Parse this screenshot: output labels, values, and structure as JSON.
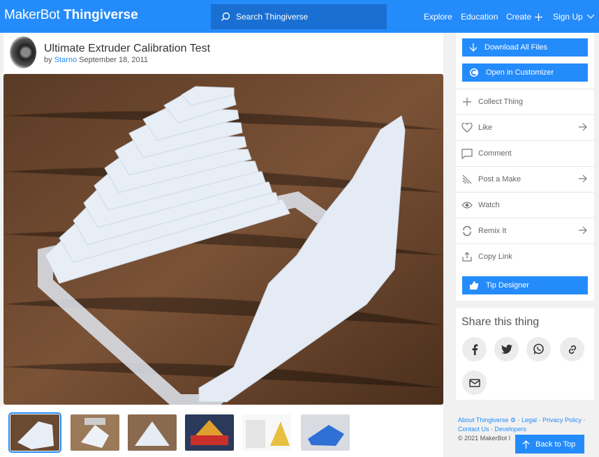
{
  "header": {
    "logo_makerbot": "MakerBot",
    "logo_thingiverse": "Thingiverse",
    "search_placeholder": "Search Thingiverse",
    "nav": {
      "explore": "Explore",
      "education": "Education",
      "create": "Create",
      "signup": "Sign Up"
    }
  },
  "thing": {
    "title": "Ultimate Extruder Calibration Test",
    "by_prefix": "by",
    "author": "Starno",
    "date": "September 18, 2011"
  },
  "thumbnails": [
    {
      "name": "thumb-1",
      "selected": true
    },
    {
      "name": "thumb-2",
      "selected": false
    },
    {
      "name": "thumb-3",
      "selected": false
    },
    {
      "name": "thumb-4",
      "selected": false
    },
    {
      "name": "thumb-5",
      "selected": false
    },
    {
      "name": "thumb-6",
      "selected": false
    }
  ],
  "sidebar": {
    "download_all": "Download All Files",
    "open_customizer": "Open in Customizer",
    "actions": {
      "collect": "Collect Thing",
      "like": "Like",
      "comment": "Comment",
      "post_make": "Post a Make",
      "watch": "Watch",
      "remix": "Remix It",
      "copy_link": "Copy Link"
    },
    "tip": "Tip Designer"
  },
  "share": {
    "title": "Share this thing",
    "icons": [
      "facebook-icon",
      "twitter-icon",
      "whatsapp-icon",
      "link-icon",
      "mail-icon"
    ]
  },
  "footer": {
    "about": "About Thingiverse",
    "legal": "Legal",
    "privacy": "Privacy Policy",
    "contact": "Contact Us",
    "developers": "Developers",
    "copyright": "©  2021 MakerBot I"
  },
  "back_to_top": "Back to Top",
  "colors": {
    "brand": "#248bfb",
    "search_bg": "#1a6fd3",
    "page_bg": "#f1f1f1"
  }
}
